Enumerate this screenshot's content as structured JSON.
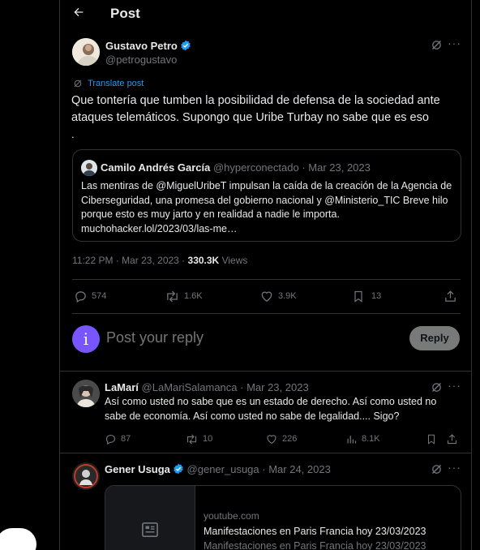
{
  "header": {
    "title": "Post"
  },
  "post": {
    "author_name": "Gustavo Petro",
    "author_handle": "@petrogustavo",
    "translate_label": "Translate post",
    "text": "Que tontería que tumben la posibilidad de defensa de la sociedad ante ataques telemáticos. Supongo que Uribe Turbay no sabe que es eso",
    "trailing": ".",
    "quote": {
      "author_name": "Camilo Andrés García",
      "author_handle": "@hyperconectado",
      "date": "· Mar 23, 2023",
      "text": "Las mentiras de @MiguelUribeT impulsan la caída de la creación de la Agencia de Ciberseguridad, una promesa del gobierno nacional y @Ministerio_TIC Breve hilo porque esto es muy jarto y en realidad a nadie le importa. muchohacker.lol/2023/03/las-me…"
    },
    "timestamp": "11:22 PM · Mar 23, 2023 ·",
    "views_count": "330.3K",
    "views_label": "Views",
    "stats": {
      "replies": "574",
      "reposts": "1.6K",
      "likes": "3.9K",
      "bookmarks": "13"
    }
  },
  "compose": {
    "avatar_letter": "i",
    "placeholder": "Post your reply",
    "button_label": "Reply"
  },
  "replies": [
    {
      "author_name": "LaMarí",
      "author_handle": "@LaMariSalamanca",
      "date": "· Mar 23, 2023",
      "text": "Así como usted no sabe que es un estado de derecho.  Así como usted no sabe de economía.  Así como usted no sabe de legalidad.... Sigo?",
      "stats": {
        "replies": "87",
        "reposts": "10",
        "likes": "226",
        "views": "8.1K"
      }
    },
    {
      "author_name": "Gener Usuga",
      "author_handle": "@gener_usuga",
      "date": "· Mar 24, 2023",
      "card": {
        "domain": "youtube.com",
        "title": "Manifestaciones en Paris Francia hoy 23/03/2023",
        "description": "Manifestaciones en Paris Francia hoy 23/03/2023"
      }
    }
  ],
  "colors": {
    "accent": "#1d9bf0",
    "background": "#000000",
    "border": "#2f3336",
    "muted": "#71767b",
    "compose_avatar": "#7856ff"
  }
}
